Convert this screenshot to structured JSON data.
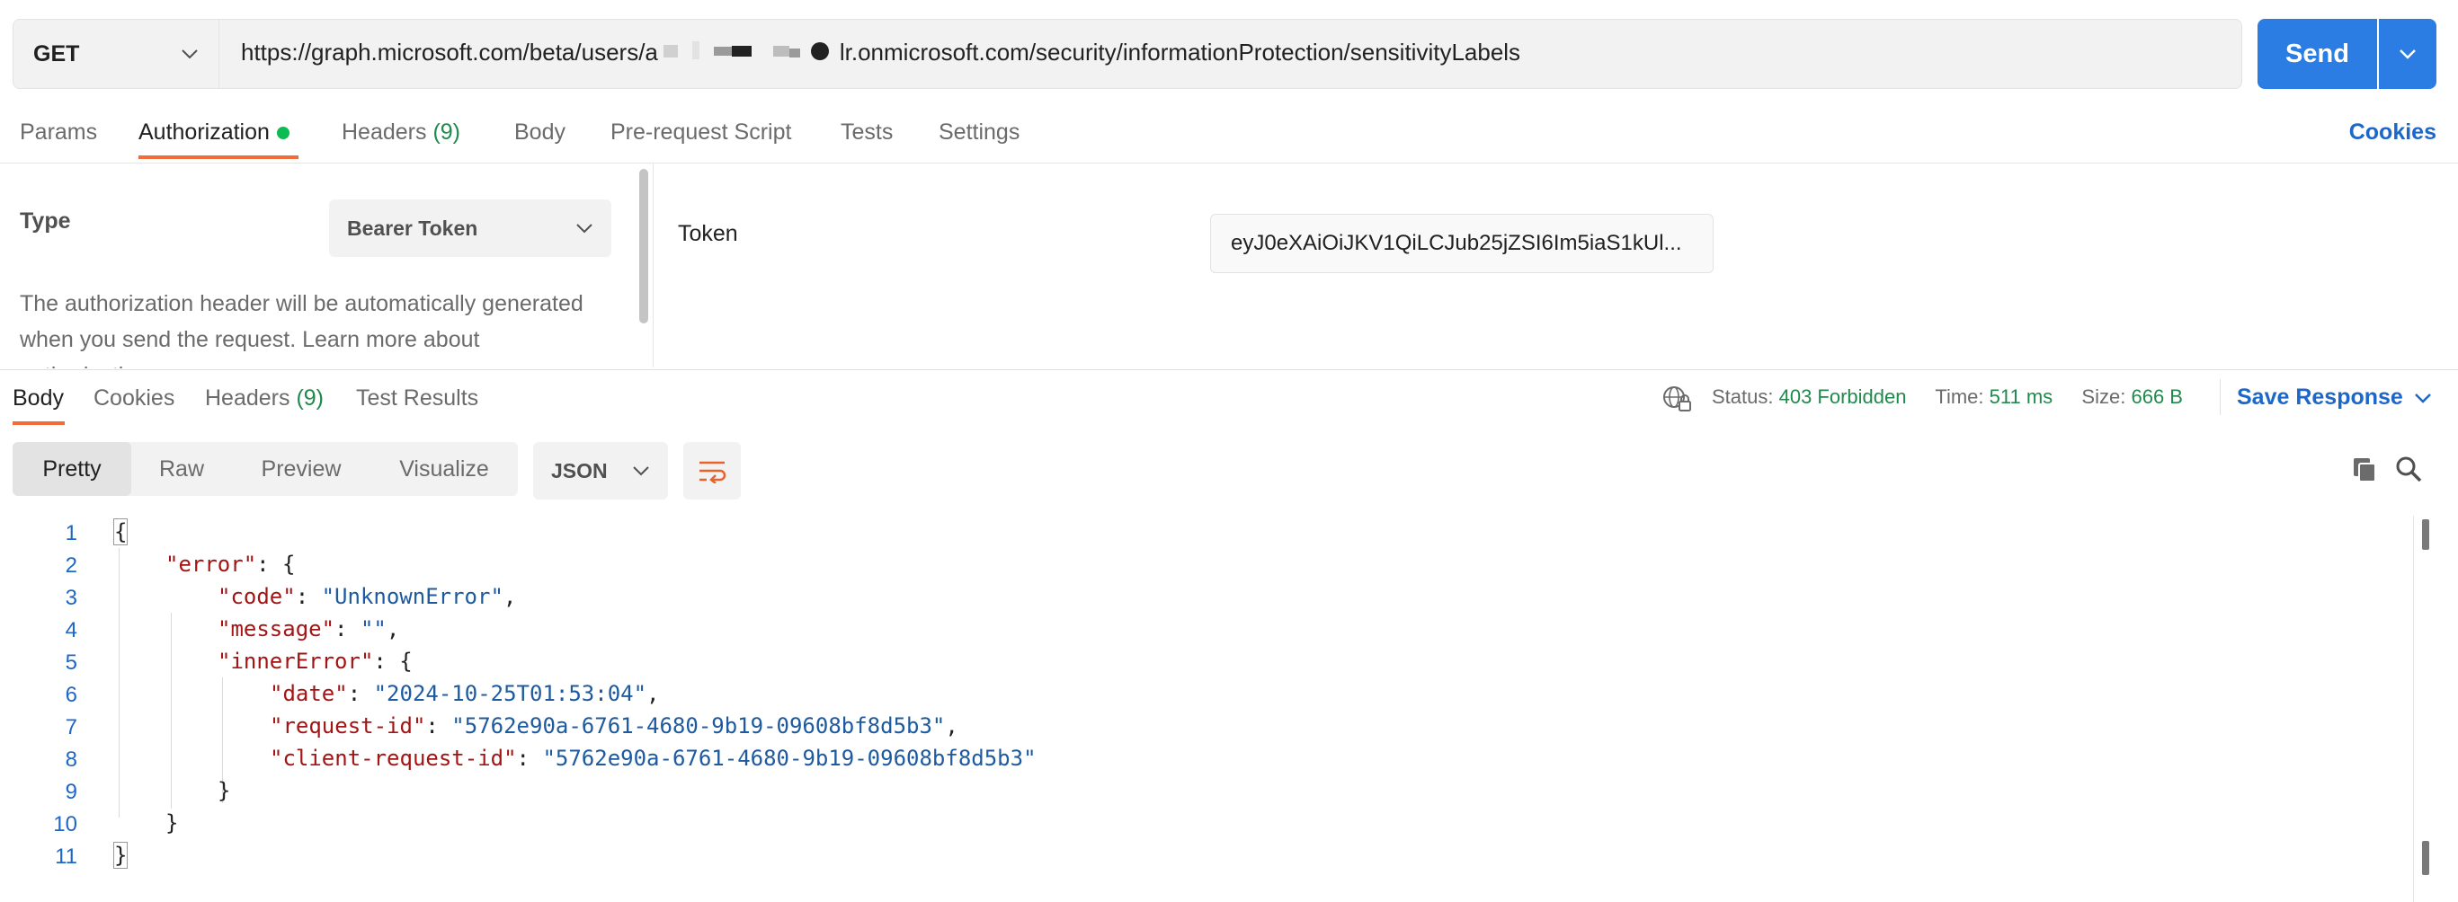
{
  "request": {
    "method": "GET",
    "url_prefix": "https://graph.microsoft.com/beta/users/a",
    "url_suffix": "lr.onmicrosoft.com/security/informationProtection/sensitivityLabels",
    "send_label": "Send"
  },
  "request_tabs": {
    "params": "Params",
    "authorization": "Authorization",
    "headers": "Headers",
    "headers_count": "(9)",
    "body": "Body",
    "pre_request": "Pre-request Script",
    "tests": "Tests",
    "settings": "Settings",
    "cookies": "Cookies"
  },
  "auth": {
    "type_label": "Type",
    "type_value": "Bearer Token",
    "description": "The authorization header will be automatically generated when you send the request. Learn more about authorization",
    "token_label": "Token",
    "token_value": "eyJ0eXAiOiJKV1QiLCJub25jZSI6Im5iaS1kUl..."
  },
  "response_tabs": {
    "body": "Body",
    "cookies": "Cookies",
    "headers": "Headers",
    "headers_count": "(9)",
    "test_results": "Test Results"
  },
  "status": {
    "status_label": "Status:",
    "status_value": "403 Forbidden",
    "time_label": "Time:",
    "time_value": "511 ms",
    "size_label": "Size:",
    "size_value": "666 B",
    "save_response": "Save Response"
  },
  "view_modes": [
    "Pretty",
    "Raw",
    "Preview",
    "Visualize"
  ],
  "format": "JSON",
  "code_lines": {
    "l1": {
      "n": "1"
    },
    "l2": {
      "n": "2",
      "key": "\"error\"",
      "rest": ": {"
    },
    "l3": {
      "n": "3",
      "key": "\"code\"",
      "sep": ": ",
      "val": "\"UnknownError\"",
      "end": ","
    },
    "l4": {
      "n": "4",
      "key": "\"message\"",
      "sep": ": ",
      "val": "\"\"",
      "end": ","
    },
    "l5": {
      "n": "5",
      "key": "\"innerError\"",
      "rest": ": {"
    },
    "l6": {
      "n": "6",
      "key": "\"date\"",
      "sep": ": ",
      "val": "\"2024-10-25T01:53:04\"",
      "end": ","
    },
    "l7": {
      "n": "7",
      "key": "\"request-id\"",
      "sep": ": ",
      "val": "\"5762e90a-6761-4680-9b19-09608bf8d5b3\"",
      "end": ","
    },
    "l8": {
      "n": "8",
      "key": "\"client-request-id\"",
      "sep": ": ",
      "val": "\"5762e90a-6761-4680-9b19-09608bf8d5b3\"",
      "end": ""
    },
    "l9": {
      "n": "9",
      "text": "}"
    },
    "l10": {
      "n": "10",
      "text": "}"
    },
    "l11": {
      "n": "11"
    }
  },
  "colors": {
    "accent": "#2b7de4",
    "tab_active": "#f26b3a",
    "status_ok": "#1f8a4c",
    "link": "#1d67c9"
  }
}
